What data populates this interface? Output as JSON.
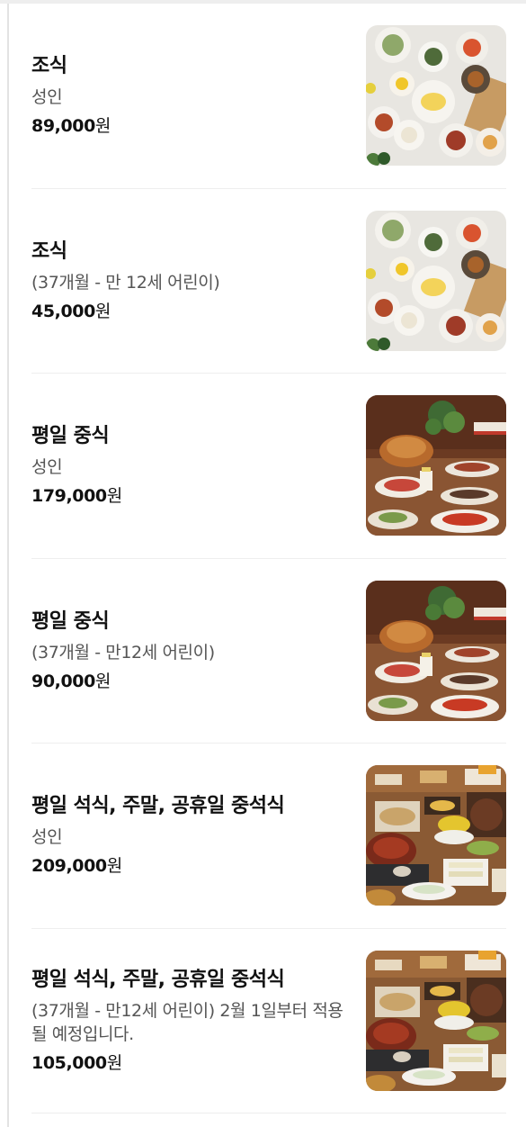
{
  "menu": {
    "items": [
      {
        "title": "조식",
        "subtitle": "성인",
        "price_number": "89,000",
        "price_unit": "원",
        "image": "breakfast-buffet-photo"
      },
      {
        "title": "조식",
        "subtitle": "(37개월 - 만 12세 어린이)",
        "price_number": "45,000",
        "price_unit": "원",
        "image": "breakfast-buffet-photo"
      },
      {
        "title": "평일 중식",
        "subtitle": "성인",
        "price_number": "179,000",
        "price_unit": "원",
        "image": "lunch-buffet-photo"
      },
      {
        "title": "평일 중식",
        "subtitle": "(37개월 - 만12세 어린이)",
        "price_number": "90,000",
        "price_unit": "원",
        "image": "lunch-buffet-photo"
      },
      {
        "title": "평일 석식, 주말, 공휴일 중석식",
        "subtitle": "성인",
        "price_number": "209,000",
        "price_unit": "원",
        "image": "dinner-buffet-photo"
      },
      {
        "title": "평일 석식, 주말, 공휴일 중석식",
        "subtitle": "(37개월 - 만12세 어린이) 2월 1일부터 적용될 예정입니다.",
        "price_number": "105,000",
        "price_unit": "원",
        "image": "dinner-buffet-photo"
      }
    ]
  }
}
